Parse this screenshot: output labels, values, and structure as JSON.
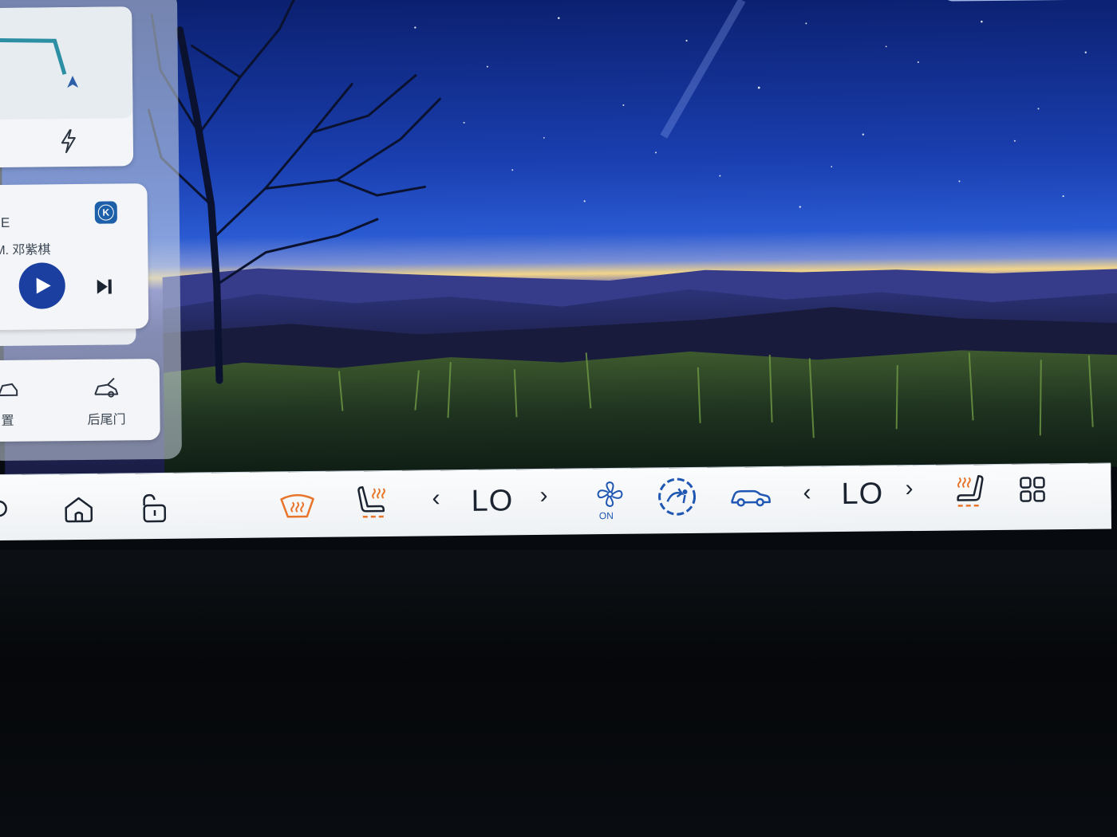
{
  "music": {
    "title_fragment": "E",
    "artist_fragment": "M. 邓紫棋",
    "source_badge": "K",
    "icons": {
      "play": "play-icon",
      "next": "next-track-icon",
      "source": "k-app-icon"
    }
  },
  "navigation": {
    "icons": {
      "charge": "lightning-icon",
      "arrow": "navigation-arrow-icon"
    }
  },
  "shortcuts": {
    "items": [
      {
        "label": "置",
        "icon": "car-icon"
      },
      {
        "label": "后尾门",
        "icon": "tailgate-icon"
      }
    ]
  },
  "dock": {
    "left_temp": "LO",
    "right_temp": "LO",
    "fan_status": "ON",
    "chevron_left": "‹",
    "chevron_right": "›",
    "accent_orange": "#e8752a",
    "accent_blue": "#1f57b3",
    "icons": [
      "home-icon",
      "unlock-icon",
      "rear-defrost-icon",
      "seat-heat-icon",
      "fan-icon",
      "air-recirculation-icon",
      "car-outline-icon",
      "seat-heat-icon",
      "apps-grid-icon"
    ]
  }
}
